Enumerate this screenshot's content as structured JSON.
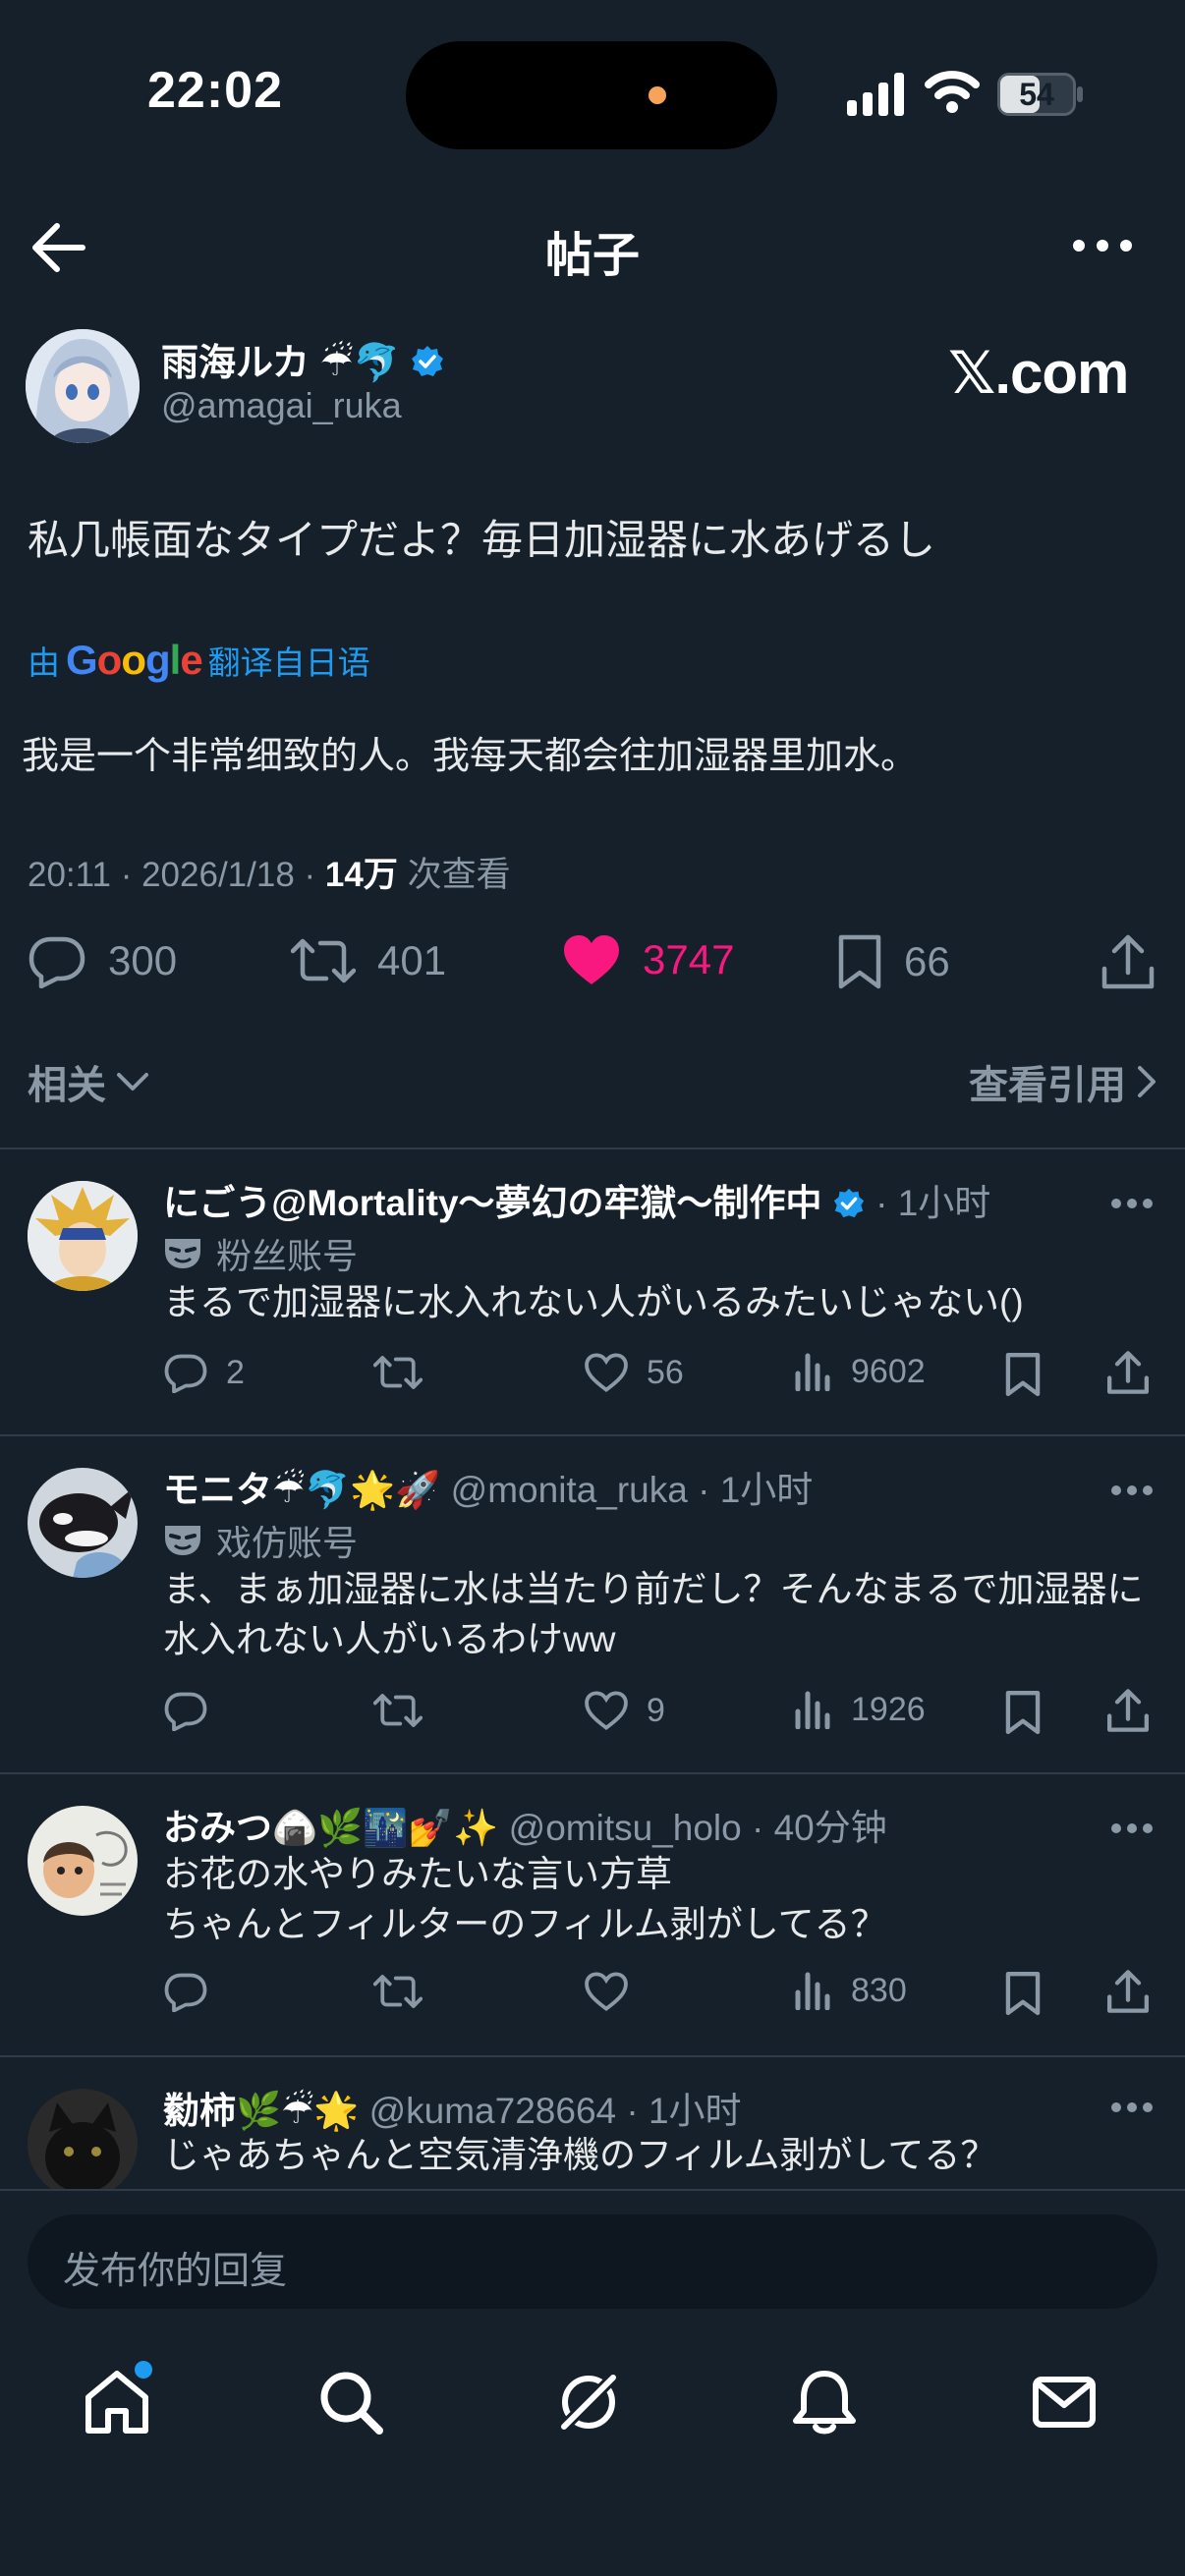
{
  "status_bar": {
    "time": "22:02",
    "battery": "54",
    "battery_level": 0.54
  },
  "header": {
    "title": "帖子"
  },
  "post": {
    "author_name": "雨海ルカ",
    "author_emoji": "☔🐬",
    "handle": "@amagai_ruka",
    "watermark": "𝕏.com",
    "text": "私几帳面なタイプだよ？毎日加湿器に水あげるし",
    "translated_prefix": "由",
    "translated_logo": "Google",
    "translated_suffix": "翻译自日语",
    "translation": "我是一个非常细致的人。我每天都会往加湿器里加水。",
    "meta_time": "20:11 · 2026/1/18 · ",
    "meta_views": "14万",
    "meta_views_label": " 次查看",
    "replies": "300",
    "reposts": "401",
    "likes": "3747",
    "bookmarks": "66",
    "colors": {
      "like": "#f91880",
      "link": "#1d9bf0"
    }
  },
  "related": {
    "label": "相关",
    "quotes_label": "查看引用"
  },
  "replies": [
    {
      "name": "にごう@Mortality～夢幻の牢獄～制作中",
      "verified": true,
      "meta": " · 1小时",
      "badge": "粉丝账号",
      "text": "まるで加湿器に水入れない人がいるみたいじゃない()",
      "replies": "2",
      "reposts": "",
      "likes": "56",
      "views": "9602"
    },
    {
      "name": "モニタ☔🐬🌟🚀",
      "meta": " @monita_ruka · 1小时",
      "badge": "戏仿账号",
      "text": "ま、まぁ加湿器に水は当たり前だし？そんなまるで加湿器に水入れない人がいるわけww",
      "replies": "",
      "reposts": "",
      "likes": "9",
      "views": "1926"
    },
    {
      "name": "おみつ🍙🌿🌃💅✨",
      "meta": " @omitsu_holo · 40分钟",
      "text_line1": "お花の水やりみたいな言い方草",
      "text_line2": "ちゃんとフィルターのフィルム剥がしてる？",
      "replies": "",
      "reposts": "",
      "likes": "",
      "views": "830"
    },
    {
      "name": "勬柿🌿☔🌟",
      "meta": " @kuma728664 · 1小时",
      "text": "じゃあちゃんと空気清浄機のフィルム剥がしてる？"
    }
  ],
  "composer": {
    "placeholder": "发布你的回复"
  },
  "nav": [
    "home-icon",
    "search-icon",
    "grok-icon",
    "bell-icon",
    "mail-icon"
  ]
}
